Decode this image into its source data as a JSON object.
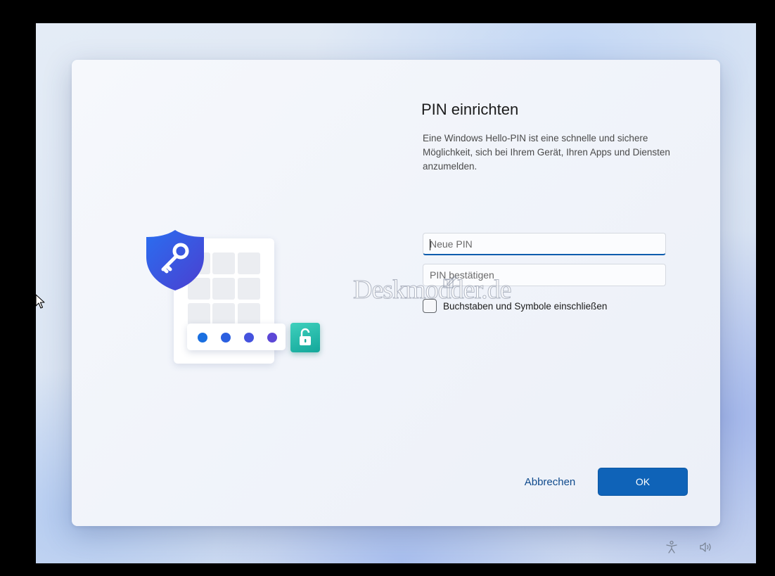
{
  "dialog": {
    "title": "PIN einrichten",
    "description": "Eine Windows Hello-PIN ist eine schnelle und sichere Möglichkeit, sich bei Ihrem Gerät, Ihren Apps und Diensten anzumelden.",
    "new_pin": {
      "placeholder": "Neue PIN",
      "value": ""
    },
    "confirm_pin": {
      "placeholder": "PIN bestätigen",
      "value": ""
    },
    "include_letters_checkbox": {
      "label": "Buchstaben und Symbole einschließen",
      "checked": false
    },
    "cancel_label": "Abbrechen",
    "ok_label": "OK"
  },
  "watermark": "Deskmodder.de",
  "illustration": {
    "icons": [
      "shield-key-icon",
      "keypad",
      "pin-dots",
      "unlocked-padlock-icon"
    ],
    "dot_colors": [
      "#1a6fe0",
      "#2b5fe0",
      "#4553de",
      "#5c47d6"
    ]
  },
  "system_tray": {
    "icons": [
      "accessibility-icon",
      "volume-icon"
    ]
  },
  "colors": {
    "accent": "#0f63b8",
    "link": "#0f4a8c"
  }
}
